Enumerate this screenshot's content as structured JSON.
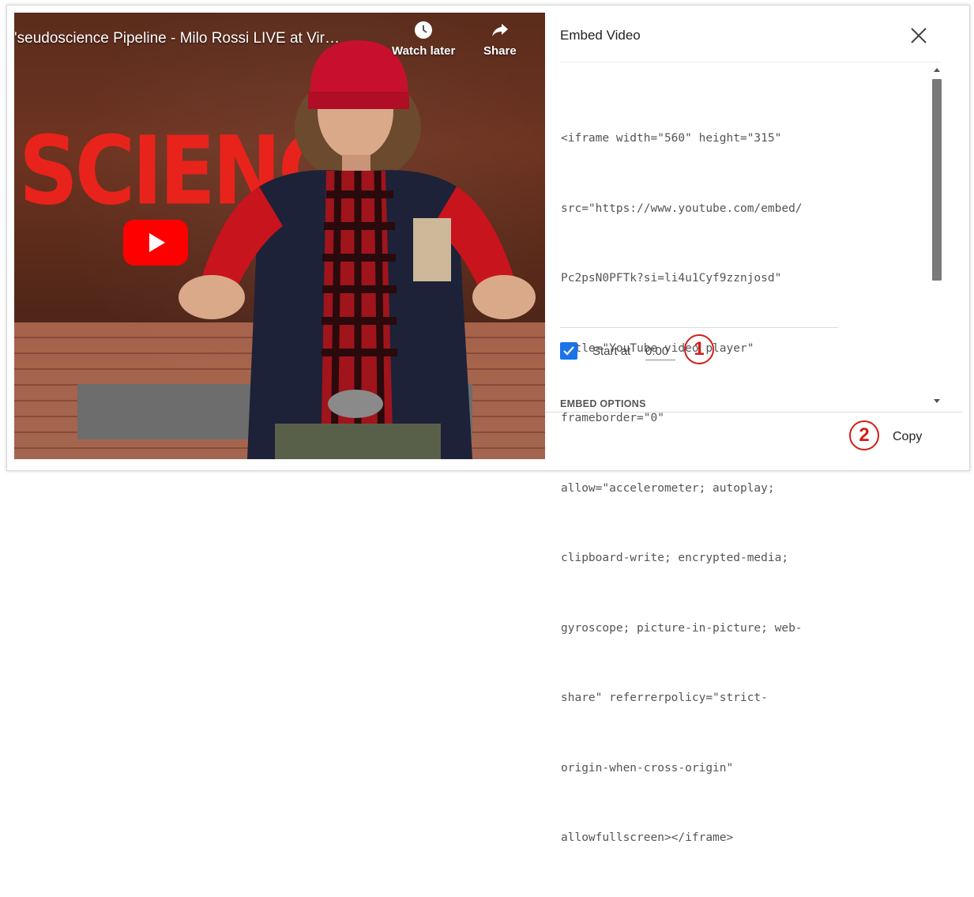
{
  "video": {
    "title": "'seudoscience Pipeline - Milo Rossi LIVE at Vir…",
    "watch_later_label": "Watch later",
    "share_label": "Share",
    "overlay_text": "SCIENCE"
  },
  "panel": {
    "title": "Embed Video",
    "code_lines": [
      "<iframe width=\"560\" height=\"315\"",
      "src=\"https://www.youtube.com/embed/",
      "Pc2psN0PFTk?si=li4u1Cyf9zznjosd\"",
      "title=\"YouTube video player\"",
      "frameborder=\"0\"",
      "allow=\"accelerometer; autoplay;",
      "clipboard-write; encrypted-media;",
      "gyroscope; picture-in-picture; web-",
      "share\" referrerpolicy=\"strict-",
      "origin-when-cross-origin\"",
      "allowfullscreen></iframe>"
    ],
    "start_at_label": "Start at",
    "start_at_value": "0:00",
    "start_at_checked": true,
    "embed_options_label": "EMBED OPTIONS",
    "copy_label": "Copy"
  },
  "annotations": {
    "one": "1",
    "two": "2"
  },
  "colors": {
    "checkbox": "#1a73e8",
    "annotation": "#d01f17",
    "play_button": "#ff0000"
  }
}
